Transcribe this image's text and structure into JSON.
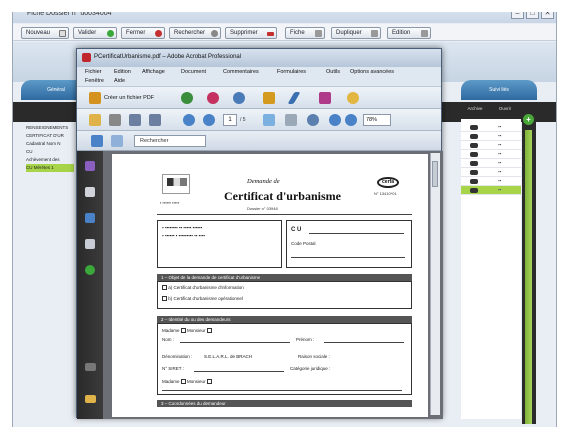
{
  "bg_window": {
    "title": "Fiche Dossier n° u0034004",
    "controls": [
      "–",
      "□",
      "✕"
    ],
    "toolbar": [
      {
        "label": "Nouveau",
        "color": "#e8e8e8"
      },
      {
        "label": "Valider",
        "color": "#3aa83a"
      },
      {
        "label": "Fermer",
        "color": "#c43030"
      },
      {
        "label": "Rechercher",
        "color": "#999999"
      },
      {
        "label": "Supprimer",
        "color": "#c43030"
      },
      {
        "label": "Fiche",
        "color": "#999999"
      },
      {
        "label": "Dupliquer",
        "color": "#999999"
      },
      {
        "label": "Edition",
        "color": "#999999"
      }
    ],
    "tabs": [
      "Général",
      "Suivi liés"
    ],
    "list_items": [
      "RENSEIGNEMENTS",
      "CERTIFICAT D'UR",
      "Cadastral Nom N",
      "CU",
      "Achèvement des",
      "CU Mérétes 1"
    ],
    "selected_list_index": 5,
    "grid_headers": [
      "Archive",
      "Ouvrir"
    ],
    "grid_rows": 8,
    "selected_grid_row": 7
  },
  "acrobat": {
    "title": "PCertificatUrbanisme.pdf – Adobe Acrobat Professional",
    "menu_row1": [
      "Fichier",
      "Edition",
      "Affichage",
      "Document",
      "Commentaires",
      "Formulaires",
      "Outils",
      "Options avancées"
    ],
    "menu_row2": [
      "Fenêtre",
      "Aide"
    ],
    "create_pdf_label": "Créer un fichier PDF",
    "page_number": "1",
    "page_total": "/ 5",
    "zoom": "78%",
    "search_placeholder": "Rechercher"
  },
  "document": {
    "demande_de": "Demande de",
    "title": "Certificat d'urbanisme",
    "subtitle": "Dossier n° 03948",
    "cerfa_label": "cerfa",
    "cerfa_number": "N° 13410*01",
    "sections": [
      "1 – Objet de la demande de certificat d'urbanisme",
      "2 – Identité du ou des demandeurs",
      "3 – Coordonnées du demandeur"
    ],
    "fields": {
      "cu_label": "C U",
      "code_label": "Code Postal",
      "nom_label": "Nom :",
      "prenom_label": "Prénom :",
      "denomination_label": "Dénomination :",
      "denomination_value": "S.E.L.A.R.L. de BRACH",
      "raison_label": "Raison sociale :",
      "siret_label": "N° SIRET :",
      "categorie_label": "Catégorie juridique :",
      "madame": "Madame",
      "monsieur": "Monsieur"
    },
    "objet_options": [
      "a) Certificat d'urbanisme d'information",
      "b) Certificat d'urbanisme opérationnel"
    ]
  },
  "colors": {
    "accent_green": "#a8d44a",
    "acrobat_red": "#c0262d",
    "nav_dark": "#2a2a2a"
  }
}
